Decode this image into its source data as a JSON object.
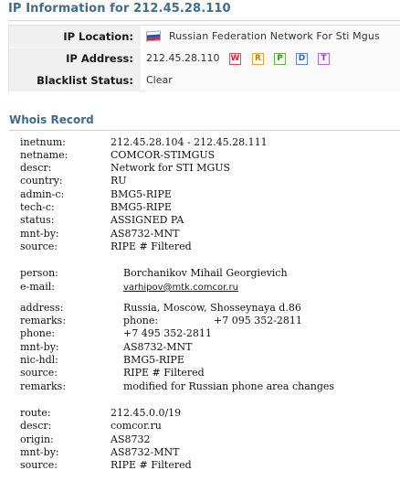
{
  "title": "IP Information for 212.45.28.110",
  "ip_info": {
    "location_label": "IP Location:",
    "location_value": "Russian Federation Network For Sti Mgus",
    "flag_icon": "russian-flag",
    "address_label": "IP Address:",
    "address_value": "212.45.28.110",
    "tools": [
      "W",
      "R",
      "P",
      "D",
      "T"
    ],
    "blacklist_label": "Blacklist Status:",
    "blacklist_value": "Clear"
  },
  "whois": {
    "title": "Whois Record",
    "block1": [
      {
        "k": "inetnum:",
        "v": "212.45.28.104 - 212.45.28.111"
      },
      {
        "k": "netname:",
        "v": "COMCOR-STIMGUS"
      },
      {
        "k": "descr:",
        "v": "Network for STI MGUS"
      },
      {
        "k": "country:",
        "v": "RU"
      },
      {
        "k": "admin-c:",
        "v": "BMG5-RIPE"
      },
      {
        "k": "tech-c:",
        "v": "BMG5-RIPE"
      },
      {
        "k": "status:",
        "v": "ASSIGNED PA"
      },
      {
        "k": "mnt-by:",
        "v": "AS8732-MNT"
      },
      {
        "k": "source:",
        "v": "RIPE # Filtered"
      }
    ],
    "block2": [
      {
        "k": "person:",
        "v": "Borchanikov Mihail Georgievich"
      },
      {
        "k": "e-mail:",
        "v": "varhipov@mtk.comcor.ru"
      }
    ],
    "block3": [
      {
        "k": "address:",
        "v": "Russia, Moscow, Shosseynaya d.86"
      },
      {
        "k": "remarks:",
        "v": "phone:",
        "v2": "+7 095 352-2811"
      },
      {
        "k": "phone:",
        "v": "+7 495 352-2811"
      },
      {
        "k": "mnt-by:",
        "v": "AS8732-MNT"
      },
      {
        "k": "nic-hdl:",
        "v": "BMG5-RIPE"
      },
      {
        "k": "source:",
        "v": "RIPE # Filtered"
      },
      {
        "k": "remarks:",
        "v": "modified for Russian phone area changes"
      }
    ],
    "block4": [
      {
        "k": "route:",
        "v": "212.45.0.0/19"
      },
      {
        "k": "descr:",
        "v": "comcor.ru"
      },
      {
        "k": "origin:",
        "v": "AS8732"
      },
      {
        "k": "mnt-by:",
        "v": "AS8732-MNT"
      },
      {
        "k": "source:",
        "v": "RIPE # Filtered"
      }
    ]
  }
}
